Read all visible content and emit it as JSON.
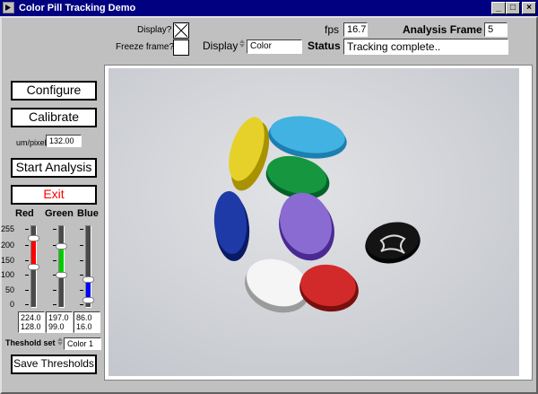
{
  "window": {
    "title": "Color Pill Tracking Demo",
    "minimize": "_",
    "maximize": "□",
    "close": "×"
  },
  "top": {
    "display_label": "Display?",
    "freeze_label": "Freeze frame?",
    "display_mode_label": "Display",
    "display_mode_value": "Color",
    "fps_label": "fps",
    "fps_value": "16.7",
    "analysis_frame_label": "Analysis Frame #",
    "analysis_frame_value": "5",
    "status_label": "Status",
    "status_value": "Tracking complete.."
  },
  "left": {
    "configure": "Configure",
    "calibrate": "Calibrate",
    "um_pixel_label": "um/pixel",
    "um_pixel_value": "132.00",
    "start_analysis": "Start Analysis",
    "exit": "Exit",
    "exit_color": "#ff0000",
    "channels": [
      {
        "name": "Red",
        "color": "#ff0000",
        "hi": "224.0",
        "lo": "128.0",
        "hi_num": 224,
        "lo_num": 128
      },
      {
        "name": "Green",
        "color": "#00cc00",
        "hi": "197.0",
        "lo": "99.0",
        "hi_num": 197,
        "lo_num": 99
      },
      {
        "name": "Blue",
        "color": "#0000ff",
        "hi": "86.0",
        "lo": "16.0",
        "hi_num": 86,
        "lo_num": 16
      }
    ],
    "scale": [
      "255",
      "200",
      "150",
      "100",
      "50",
      "0"
    ],
    "threshold_label": "Theshold set",
    "threshold_value": "Color 1",
    "save_thresholds": "Save Thresholds"
  }
}
